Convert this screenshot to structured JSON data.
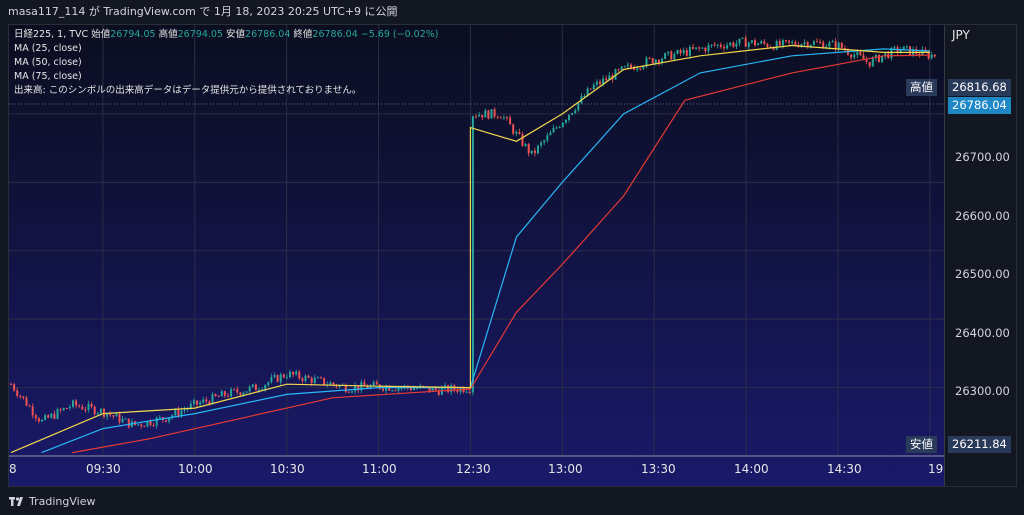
{
  "header": {
    "publisher_line": "masa117_114 が TradingView.com で 1月 18, 2023 20:25 UTC+9 に公開"
  },
  "legend": {
    "symbol": "日経225, 1, TVC",
    "open_label": "始値",
    "open_value": "26794.05",
    "high_label": "高値",
    "high_value": "26794.05",
    "low_label": "安値",
    "low_value": "26786.04",
    "close_label": "終値",
    "close_value": "26786.04",
    "change": "−5.69 (−0.02%)",
    "ma1": "MA (25, close)",
    "ma2": "MA (50, close)",
    "ma3": "MA (75, close)",
    "volume_note": "出来高: このシンボルの出来高データはデータ提供元から提供されておりません。"
  },
  "axis": {
    "currency": "JPY",
    "high_tag_label": "高値",
    "high_tag_value": "26816.68",
    "current_value": "26786.04",
    "low_tag_label": "安値",
    "low_tag_value": "26211.84",
    "price_ticks": [
      "26700.00",
      "26600.00",
      "26500.00",
      "26400.00",
      "26300.00"
    ]
  },
  "footer": {
    "brand": "TradingView"
  },
  "colors": {
    "up": "#26a69a",
    "down": "#ef5350",
    "ma25": "#f5d94a",
    "ma50": "#29b6f6",
    "ma75": "#e53935",
    "background_top": "#0b0e1f",
    "background_bottom": "#19196a"
  },
  "chart_data": {
    "type": "candlestick",
    "x_ticks": [
      "8",
      "09:30",
      "10:00",
      "10:30",
      "11:00",
      "12:30",
      "13:00",
      "13:30",
      "14:00",
      "14:30",
      "19"
    ],
    "y_range": [
      26200,
      26830
    ],
    "price_high": 26816.68,
    "price_low": 26211.84,
    "price_current": 26786.04,
    "close_series": [
      {
        "t": "09:00",
        "v": 26305
      },
      {
        "t": "09:10",
        "v": 26250
      },
      {
        "t": "09:20",
        "v": 26275
      },
      {
        "t": "09:30",
        "v": 26265
      },
      {
        "t": "09:40",
        "v": 26245
      },
      {
        "t": "09:50",
        "v": 26255
      },
      {
        "t": "10:00",
        "v": 26275
      },
      {
        "t": "10:10",
        "v": 26290
      },
      {
        "t": "10:20",
        "v": 26300
      },
      {
        "t": "10:30",
        "v": 26320
      },
      {
        "t": "10:40",
        "v": 26310
      },
      {
        "t": "10:50",
        "v": 26300
      },
      {
        "t": "11:00",
        "v": 26302
      },
      {
        "t": "11:10",
        "v": 26300
      },
      {
        "t": "11:20",
        "v": 26296
      },
      {
        "t": "11:30",
        "v": 26300
      },
      {
        "t": "12:30",
        "v": 26700
      },
      {
        "t": "12:40",
        "v": 26700
      },
      {
        "t": "12:50",
        "v": 26640
      },
      {
        "t": "13:00",
        "v": 26690
      },
      {
        "t": "13:10",
        "v": 26740
      },
      {
        "t": "13:20",
        "v": 26765
      },
      {
        "t": "13:30",
        "v": 26780
      },
      {
        "t": "13:40",
        "v": 26790
      },
      {
        "t": "13:50",
        "v": 26800
      },
      {
        "t": "14:00",
        "v": 26805
      },
      {
        "t": "14:10",
        "v": 26800
      },
      {
        "t": "14:20",
        "v": 26805
      },
      {
        "t": "14:30",
        "v": 26800
      },
      {
        "t": "14:40",
        "v": 26775
      },
      {
        "t": "14:50",
        "v": 26795
      },
      {
        "t": "15:00",
        "v": 26786
      }
    ],
    "ma_series": [
      {
        "name": "MA (25, close)",
        "points": [
          {
            "t": "09:00",
            "v": 26205
          },
          {
            "t": "09:30",
            "v": 26262
          },
          {
            "t": "10:00",
            "v": 26270
          },
          {
            "t": "10:30",
            "v": 26305
          },
          {
            "t": "11:00",
            "v": 26302
          },
          {
            "t": "11:30",
            "v": 26300
          },
          {
            "t": "12:30",
            "v": 26680
          },
          {
            "t": "12:45",
            "v": 26660
          },
          {
            "t": "13:00",
            "v": 26700
          },
          {
            "t": "13:20",
            "v": 26765
          },
          {
            "t": "13:45",
            "v": 26785
          },
          {
            "t": "14:15",
            "v": 26800
          },
          {
            "t": "14:45",
            "v": 26790
          },
          {
            "t": "15:00",
            "v": 26790
          }
        ]
      },
      {
        "name": "MA (50, close)",
        "points": [
          {
            "t": "09:10",
            "v": 26205
          },
          {
            "t": "09:30",
            "v": 26240
          },
          {
            "t": "10:00",
            "v": 26262
          },
          {
            "t": "10:30",
            "v": 26290
          },
          {
            "t": "11:00",
            "v": 26300
          },
          {
            "t": "11:30",
            "v": 26300
          },
          {
            "t": "12:45",
            "v": 26520
          },
          {
            "t": "13:00",
            "v": 26600
          },
          {
            "t": "13:20",
            "v": 26700
          },
          {
            "t": "13:45",
            "v": 26760
          },
          {
            "t": "14:15",
            "v": 26785
          },
          {
            "t": "14:45",
            "v": 26795
          },
          {
            "t": "15:00",
            "v": 26792
          }
        ]
      },
      {
        "name": "MA (75, close)",
        "points": [
          {
            "t": "09:20",
            "v": 26205
          },
          {
            "t": "09:45",
            "v": 26225
          },
          {
            "t": "10:15",
            "v": 26255
          },
          {
            "t": "10:45",
            "v": 26285
          },
          {
            "t": "11:30",
            "v": 26298
          },
          {
            "t": "12:45",
            "v": 26410
          },
          {
            "t": "13:00",
            "v": 26480
          },
          {
            "t": "13:20",
            "v": 26580
          },
          {
            "t": "13:40",
            "v": 26720
          },
          {
            "t": "14:15",
            "v": 26760
          },
          {
            "t": "14:45",
            "v": 26785
          },
          {
            "t": "15:00",
            "v": 26786
          }
        ]
      }
    ]
  }
}
